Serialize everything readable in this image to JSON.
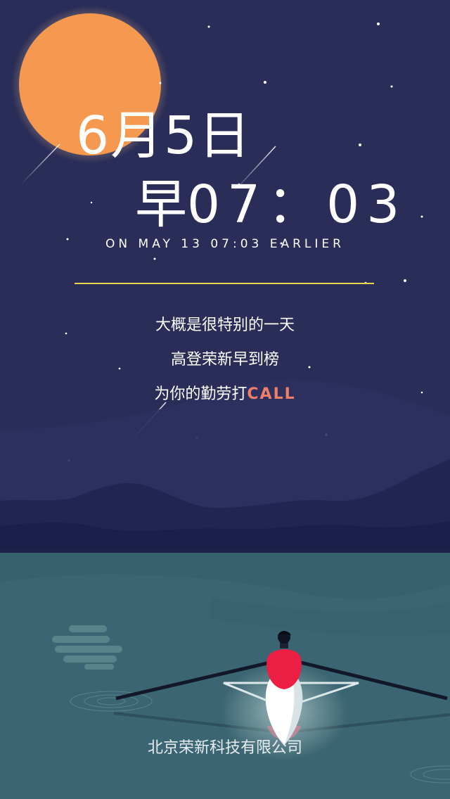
{
  "poster": {
    "date": "6月5日",
    "time_prefix": "早",
    "time": "07：03",
    "subtitle": "ON MAY 13 07:03 EARLIER",
    "lines": [
      "大概是很特别的一天",
      "高登荣新早到榜",
      "为你的勤劳打"
    ],
    "call_word": "CALL",
    "company": "北京荣新科技有限公司"
  },
  "colors": {
    "sky": "#2a2d57",
    "moon": "#f4994f",
    "divider": "#e9d44a",
    "call_accent": "#ef7f6b",
    "water": "#3b6572",
    "rower_shirt": "#ec1e43"
  }
}
